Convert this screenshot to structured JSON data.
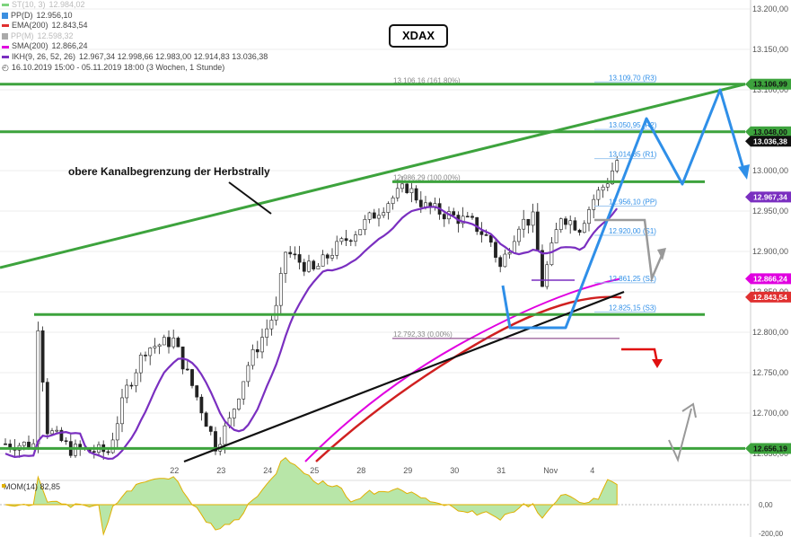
{
  "title": "XDAX",
  "legend": [
    {
      "label": "ST(10, 3)",
      "value": "12.984,02",
      "color": "#7dd37d",
      "faded": true,
      "shape": "dash"
    },
    {
      "label": "PP(D)",
      "value": "12.956,10",
      "color": "#3b8fe0",
      "faded": false,
      "shape": "square"
    },
    {
      "label": "EMA(200)",
      "value": "12.843,54",
      "color": "#e03030",
      "faded": false,
      "shape": "dash"
    },
    {
      "label": "PP(M)",
      "value": "12.598,32",
      "color": "#aaaaaa",
      "faded": true,
      "shape": "square"
    },
    {
      "label": "SMA(200)",
      "value": "12.866,24",
      "color": "#e000e0",
      "faded": false,
      "shape": "dash"
    },
    {
      "label": "IKH(9, 26, 52, 26)",
      "value": "12.967,34  12.998,66  12.983,00  12.914,83  13.036,38",
      "color": "#7a2fc0",
      "faded": false,
      "shape": "dash"
    },
    {
      "label": "16.10.2019 15:00 - 05.11.2019 18:00  (3 Wochen, 1 Stunde)",
      "value": "",
      "color": "#333333",
      "faded": false,
      "shape": "clock"
    }
  ],
  "annotation": "obere Kanalbegrenzung der Herbstrally",
  "colors": {
    "green": "#3da33d",
    "blue": "#2f8fe8",
    "black": "#111111",
    "red": "#e01010",
    "gray": "#999999",
    "purple": "#7a2fc0",
    "magenta": "#e000e0",
    "redline": "#d02020"
  },
  "chart_data": {
    "type": "candlestick",
    "title": "XDAX",
    "y_axis": {
      "min": 12640,
      "max": 13200,
      "ticks": [
        {
          "value": 13200,
          "label": "13.200,00"
        },
        {
          "value": 13150,
          "label": "13.150,00"
        },
        {
          "value": 13100,
          "label": "13.100,00"
        },
        {
          "value": 13050,
          "label": "13.050,00"
        },
        {
          "value": 13000,
          "label": "13.000,00"
        },
        {
          "value": 12950,
          "label": "12.950,00"
        },
        {
          "value": 12900,
          "label": "12.900,00"
        },
        {
          "value": 12850,
          "label": "12.850,00"
        },
        {
          "value": 12800,
          "label": "12.800,00"
        },
        {
          "value": 12750,
          "label": "12.750,00"
        },
        {
          "value": 12700,
          "label": "12.700,00"
        },
        {
          "value": 12650,
          "label": "12.650,00"
        }
      ]
    },
    "x_axis": {
      "labels": [
        "22",
        "23",
        "24",
        "25",
        "28",
        "29",
        "30",
        "31",
        "Nov",
        "4"
      ],
      "index": [
        36,
        46,
        56,
        66,
        76,
        86,
        96,
        106,
        116,
        126
      ]
    },
    "candles": [],
    "price_tags": [
      {
        "value": 13106.99,
        "label": "13.106,99",
        "bg": "#3da33d",
        "fg": "#111111"
      },
      {
        "value": 13048.0,
        "label": "13.048,00",
        "bg": "#3da33d",
        "fg": "#111111"
      },
      {
        "value": 13036.38,
        "label": "13.036,38",
        "bg": "#111111",
        "fg": "#ffffff"
      },
      {
        "value": 12967.34,
        "label": "12.967,34",
        "bg": "#7a2fc0",
        "fg": "#ffffff"
      },
      {
        "value": 12866.24,
        "label": "12.866,24",
        "bg": "#e000e0",
        "fg": "#ffffff"
      },
      {
        "value": 12843.54,
        "label": "12.843,54",
        "bg": "#e03030",
        "fg": "#ffffff"
      },
      {
        "value": 12656.19,
        "label": "12.656,19",
        "bg": "#3da33d",
        "fg": "#111111"
      }
    ],
    "levels": [
      {
        "value": 13106.16,
        "label": "13.106,16 (161,80%)",
        "color": "#aaaaaa"
      },
      {
        "value": 12986.29,
        "label": "12.986,29 (100,00%)",
        "color": "#aaaaaa"
      },
      {
        "value": 12792.33,
        "label": "12.792,33 (0,00%)",
        "color": "#7a2f7a"
      }
    ],
    "pivots": [
      {
        "value": 13109.7,
        "label": "13.109,70 (R3)"
      },
      {
        "value": 13050.95,
        "label": "13.050,95 (R2)"
      },
      {
        "value": 13014.85,
        "label": "13.014,85 (R1)"
      },
      {
        "value": 12956.1,
        "label": "12.956,10 (PP)"
      },
      {
        "value": 12920.0,
        "label": "12.920,00 (S1)"
      },
      {
        "value": 12861.25,
        "label": "12.861,25 (S2)"
      },
      {
        "value": 12825.15,
        "label": "12.825,15 (S3)"
      }
    ],
    "momentum": {
      "label": "MOM(14)",
      "value": "82,85",
      "y_ticks": [
        {
          "value": 0,
          "label": "0,00"
        },
        {
          "value": -200,
          "label": "-200,00"
        }
      ]
    }
  }
}
